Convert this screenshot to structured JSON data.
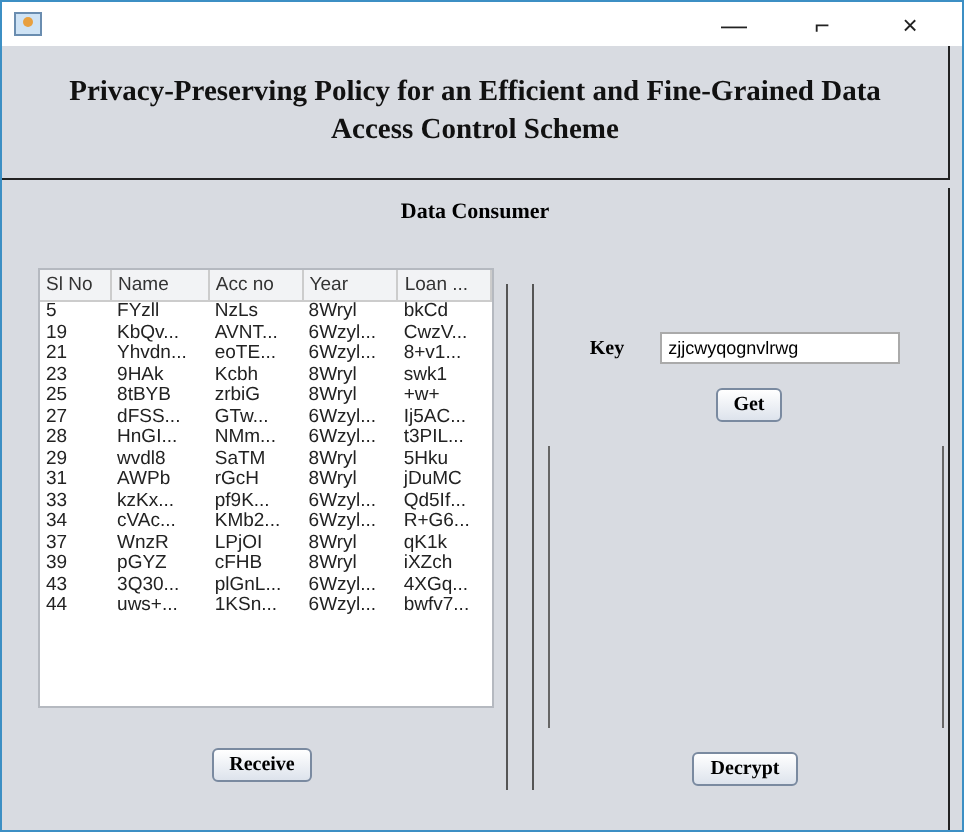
{
  "window": {
    "title_controls": [
      "—",
      "⌐",
      "×"
    ]
  },
  "header": {
    "title": "Privacy-Preserving Policy for an Efficient and Fine-Grained Data Access Control Scheme"
  },
  "section": {
    "title": "Data Consumer"
  },
  "table": {
    "columns": [
      "Sl No",
      "Name",
      "Acc no",
      "Year",
      "Loan ..."
    ],
    "rows": [
      [
        "5",
        "FYzll",
        "NzLs",
        "8Wryl",
        "bkCd"
      ],
      [
        "19",
        "KbQv...",
        "AVNT...",
        "6Wzyl...",
        "CwzV..."
      ],
      [
        "21",
        "Yhvdn...",
        "eoTE...",
        "6Wzyl...",
        "8+v1..."
      ],
      [
        "23",
        "9HAk",
        "Kcbh",
        "8Wryl",
        "swk1"
      ],
      [
        "25",
        "8tBYB",
        "zrbiG",
        "8Wryl",
        "+w+"
      ],
      [
        "27",
        "dFSS...",
        "GTw...",
        "6Wzyl...",
        "Ij5AC..."
      ],
      [
        "28",
        "HnGI...",
        "NMm...",
        "6Wzyl...",
        "t3PIL..."
      ],
      [
        "29",
        "wvdl8",
        "SaTM",
        "8Wryl",
        "5Hku"
      ],
      [
        "31",
        "AWPb",
        "rGcH",
        "8Wryl",
        "jDuMC"
      ],
      [
        "33",
        "kzKx...",
        "pf9K...",
        "6Wzyl...",
        "Qd5If..."
      ],
      [
        "34",
        "cVAc...",
        "KMb2...",
        "6Wzyl...",
        "R+G6..."
      ],
      [
        "37",
        "WnzR",
        "LPjOI",
        "8Wryl",
        "qK1k"
      ],
      [
        "39",
        "pGYZ",
        "cFHB",
        "8Wryl",
        "iXZch"
      ],
      [
        "43",
        "3Q30...",
        "plGnL...",
        "6Wzyl...",
        "4XGq..."
      ],
      [
        "44",
        "uws+...",
        "1KSn...",
        "6Wzyl...",
        "bwfv7..."
      ]
    ]
  },
  "receive_button": "Receive",
  "key": {
    "label": "Key",
    "value": "zjjcwyqognvlrwg"
  },
  "get_button": "Get",
  "decrypt_button": "Decrypt"
}
